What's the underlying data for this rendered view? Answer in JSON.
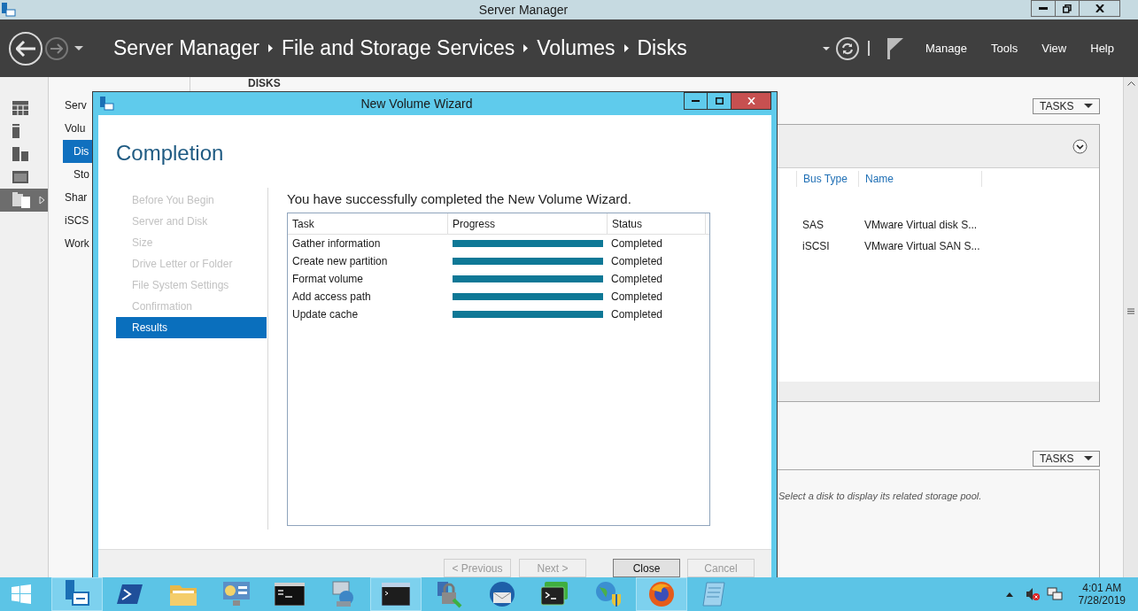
{
  "window": {
    "title": "Server Manager"
  },
  "breadcrumb": [
    "Server Manager",
    "File and Storage Services",
    "Volumes",
    "Disks"
  ],
  "menu": [
    "Manage",
    "Tools",
    "View",
    "Help"
  ],
  "icon_strip": [
    {
      "kind": "dashboard",
      "selected": false
    },
    {
      "kind": "server",
      "selected": false
    },
    {
      "kind": "servers",
      "selected": false
    },
    {
      "kind": "window",
      "selected": false
    },
    {
      "kind": "storage",
      "selected": true
    }
  ],
  "nav": [
    {
      "label": "Serv",
      "selected": false
    },
    {
      "label": "Volu",
      "selected": false,
      "children": [
        {
          "label": "Dis",
          "selected": true
        },
        {
          "label": "Sto",
          "selected": false
        }
      ]
    },
    {
      "label": "Shar",
      "selected": false
    },
    {
      "label": "iSCS",
      "selected": false
    },
    {
      "label": "Work",
      "selected": false
    }
  ],
  "content": {
    "heading": "DISKS"
  },
  "disks_panel": {
    "tasks": "TASKS",
    "columns": [
      "Bus Type",
      "Name"
    ],
    "rows": [
      [
        "SAS",
        "VMware Virtual disk S..."
      ],
      [
        "iSCSI",
        "VMware Virtual SAN S..."
      ]
    ]
  },
  "pool_panel": {
    "tasks": "TASKS",
    "message": "Select a disk to display its related storage pool."
  },
  "dialog": {
    "title": "New Volume Wizard",
    "heading": "Completion",
    "steps": [
      {
        "label": "Before You Begin",
        "selected": false
      },
      {
        "label": "Server and Disk",
        "selected": false
      },
      {
        "label": "Size",
        "selected": false
      },
      {
        "label": "Drive Letter or Folder",
        "selected": false
      },
      {
        "label": "File System Settings",
        "selected": false
      },
      {
        "label": "Confirmation",
        "selected": false
      },
      {
        "label": "Results",
        "selected": true
      }
    ],
    "message": "You have successfully completed the New Volume Wizard.",
    "columns": [
      "Task",
      "Progress",
      "Status"
    ],
    "tasks": [
      {
        "task": "Gather information",
        "level": 1,
        "status": "Completed"
      },
      {
        "task": "Create new partition",
        "level": 1,
        "status": "Completed"
      },
      {
        "task": "Format volume",
        "level": 1,
        "status": "Completed"
      },
      {
        "task": "Add access path",
        "level": 1,
        "status": "Completed"
      },
      {
        "task": "Update cache",
        "level": 1,
        "status": "Completed"
      }
    ],
    "buttons": [
      {
        "label": "< Previous",
        "disabled": true
      },
      {
        "label": "Next >",
        "disabled": true
      },
      {
        "label": "Close",
        "disabled": false
      },
      {
        "label": "Cancel",
        "disabled": true
      }
    ]
  },
  "taskbar": {
    "apps": [
      {
        "kind": "server-manager",
        "running": true
      },
      {
        "kind": "powershell",
        "running": false
      },
      {
        "kind": "folder",
        "running": false
      },
      {
        "kind": "control-panel",
        "running": false
      },
      {
        "kind": "console",
        "running": false
      },
      {
        "kind": "network",
        "running": false
      },
      {
        "kind": "window",
        "running": true
      },
      {
        "kind": "lock",
        "running": false
      },
      {
        "kind": "mail",
        "running": false
      },
      {
        "kind": "terminal",
        "running": false
      },
      {
        "kind": "globe",
        "running": false
      },
      {
        "kind": "browser",
        "running": true
      },
      {
        "kind": "notepad",
        "running": false
      }
    ],
    "clock": {
      "time": "4:01 AM",
      "date": "7/28/2019"
    }
  }
}
